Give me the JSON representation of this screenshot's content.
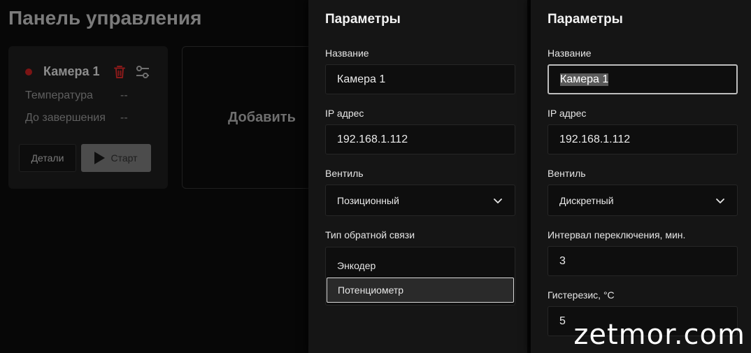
{
  "dashboard": {
    "title": "Панель управления",
    "camera": {
      "name": "Камера 1",
      "status_color": "#7c1414",
      "metrics": [
        {
          "label": "Температура",
          "value": "--"
        },
        {
          "label": "До завершения",
          "value": "--"
        }
      ],
      "details_label": "Детали",
      "start_label": "Старт",
      "delete_icon": "trash-icon",
      "settings_icon": "sliders-icon"
    },
    "add_label": "Добавить"
  },
  "panel_a": {
    "title": "Параметры",
    "name_label": "Название",
    "name_value": "Камера 1",
    "ip_label": "IP адрес",
    "ip_value": "192.168.1.112",
    "valve_label": "Вентиль",
    "valve_value": "Позиционный",
    "feedback_label": "Тип обратной связи",
    "feedback_options": [
      "Энкодер",
      "Потенциометр"
    ],
    "feedback_highlighted": "Потенциометр"
  },
  "panel_b": {
    "title": "Параметры",
    "name_label": "Название",
    "name_value": "Камера 1",
    "ip_label": "IP адрес",
    "ip_value": "192.168.1.112",
    "valve_label": "Вентиль",
    "valve_value": "Дискретный",
    "interval_label": "Интервал переключения, мин.",
    "interval_value": "3",
    "hysteresis_label": "Гистерезис, °C",
    "hysteresis_value": "5"
  },
  "watermark": "zetmor.com"
}
